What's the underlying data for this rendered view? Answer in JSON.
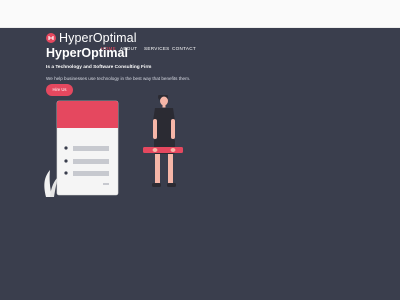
{
  "brand": {
    "name": "HyperOptimal",
    "icon": "hyperoptimal-logo-icon"
  },
  "nav": {
    "items": [
      {
        "label": "HOME",
        "active": true
      },
      {
        "label": "ABOUT",
        "active": false
      },
      {
        "label": "SERVICES",
        "active": false
      },
      {
        "label": "CONTACT",
        "active": false
      }
    ]
  },
  "hero": {
    "title": "HyperOptimal",
    "subtitle": "Is a Technology and Software Consulting Firm",
    "description": "We help businesses use technology in the best way that benefits them.",
    "cta_label": "Hire Us"
  },
  "colors": {
    "background": "#3a3e4d",
    "accent": "#e5485f",
    "topbar": "#fafafa",
    "text": "#ffffff"
  }
}
